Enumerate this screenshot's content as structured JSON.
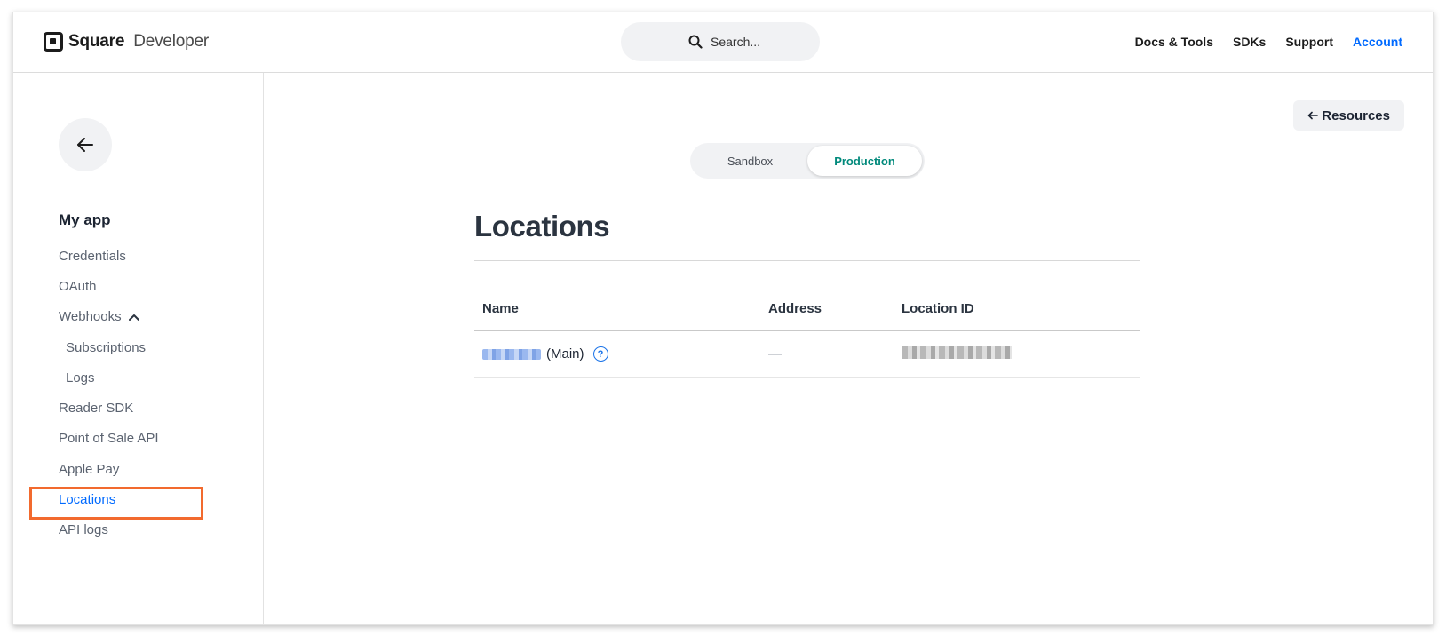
{
  "header": {
    "brand_strong": "Square",
    "brand_light": "Developer",
    "search_placeholder": "Search...",
    "nav": [
      {
        "label": "Docs & Tools"
      },
      {
        "label": "SDKs"
      },
      {
        "label": "Support"
      },
      {
        "label": "Account"
      }
    ]
  },
  "sidebar": {
    "title": "My app",
    "items": [
      {
        "label": "Credentials"
      },
      {
        "label": "OAuth"
      },
      {
        "label": "Webhooks"
      },
      {
        "label": "Subscriptions"
      },
      {
        "label": "Logs"
      },
      {
        "label": "Reader SDK"
      },
      {
        "label": "Point of Sale API"
      },
      {
        "label": "Apple Pay"
      },
      {
        "label": "Locations"
      },
      {
        "label": "API logs"
      }
    ],
    "active": "Locations"
  },
  "main": {
    "resources_label": "Resources",
    "env_tabs": [
      {
        "label": "Sandbox"
      },
      {
        "label": "Production"
      }
    ],
    "selected_env": "Production",
    "title": "Locations",
    "table": {
      "columns": [
        "Name",
        "Address",
        "Location ID"
      ],
      "rows": [
        {
          "name_suffix": "(Main)",
          "address": "—"
        }
      ]
    }
  },
  "colors": {
    "accent": "#006aff",
    "env_selected": "#00897b",
    "highlight": "#f26a2e"
  }
}
